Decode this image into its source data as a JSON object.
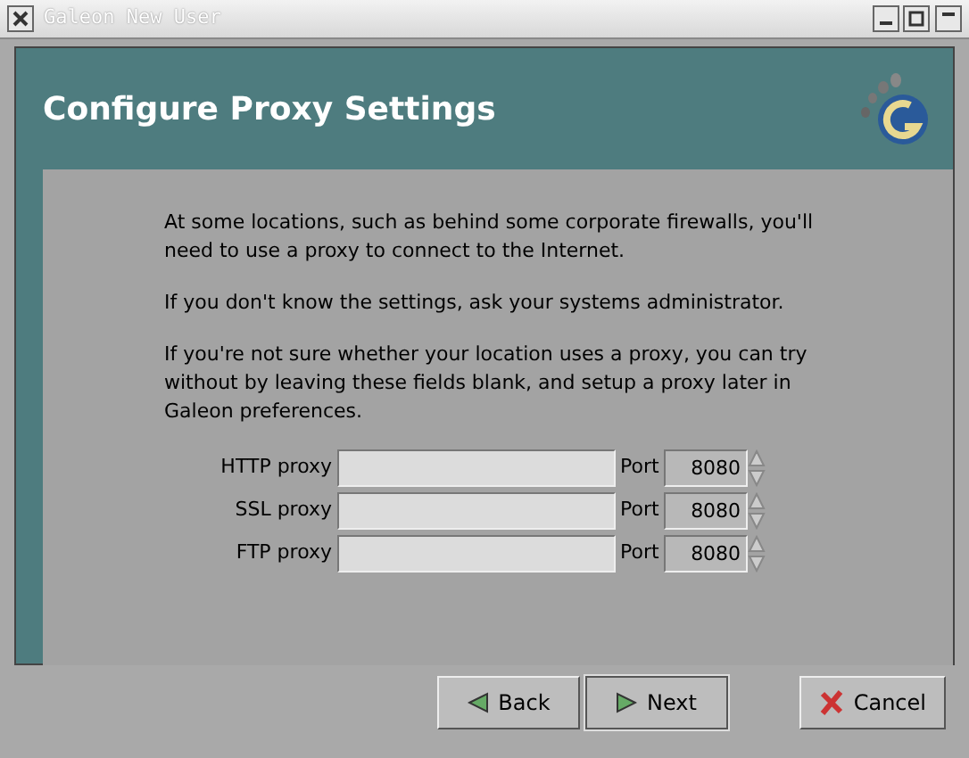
{
  "window": {
    "title": "Galeon New User"
  },
  "header": {
    "title": "Configure Proxy Settings"
  },
  "paragraphs": [
    "At some locations, such as behind some corporate firewalls, you'll need to use a proxy to connect to the Internet.",
    "If you don't know the settings, ask your systems administrator.",
    "If you're not sure whether your location uses a proxy, you can try without by leaving these fields blank, and setup a proxy later in Galeon preferences."
  ],
  "proxies": [
    {
      "label": "HTTP proxy",
      "port_label": "Port",
      "port": "8080"
    },
    {
      "label": "SSL proxy",
      "port_label": "Port",
      "port": "8080"
    },
    {
      "label": "FTP proxy",
      "port_label": "Port",
      "port": "8080"
    }
  ],
  "buttons": [
    {
      "kind": "back",
      "label": "Back",
      "selected": false
    },
    {
      "kind": "next",
      "label": "Next",
      "selected": true
    },
    {
      "kind": "cancel",
      "label": "Cancel",
      "selected": false
    }
  ]
}
